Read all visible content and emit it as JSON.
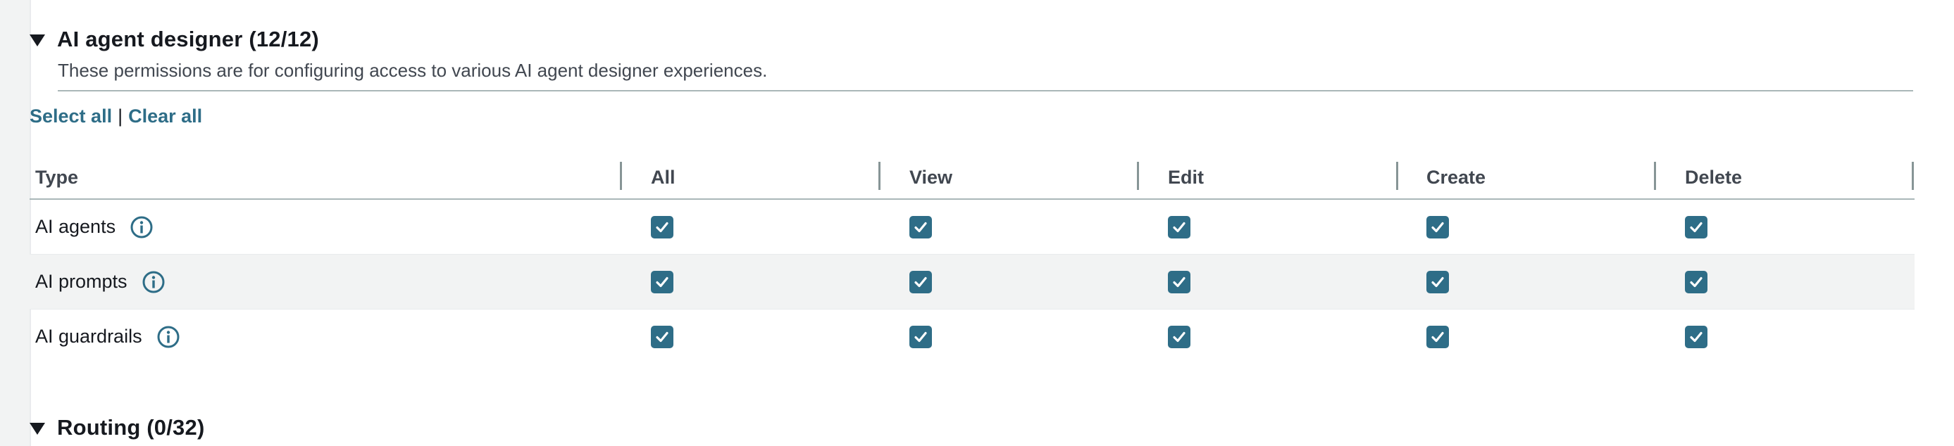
{
  "section": {
    "title": "AI agent designer (12/12)",
    "description": "These permissions are for configuring access to various AI agent designer experiences."
  },
  "actions": {
    "select_all": "Select all",
    "separator": "|",
    "clear_all": "Clear all"
  },
  "table": {
    "headers": [
      "Type",
      "All",
      "View",
      "Edit",
      "Create",
      "Delete"
    ],
    "rows": [
      {
        "type": "AI agents",
        "all": true,
        "view": true,
        "edit": true,
        "create": true,
        "delete": true
      },
      {
        "type": "AI prompts",
        "all": true,
        "view": true,
        "edit": true,
        "create": true,
        "delete": true
      },
      {
        "type": "AI guardrails",
        "all": true,
        "view": true,
        "edit": true,
        "create": true,
        "delete": true
      }
    ]
  },
  "next_section": {
    "title": "Routing (0/32)"
  },
  "colors": {
    "checkbox": "#2e6d87",
    "link": "#2e6d87",
    "row_alt": "#f2f3f3"
  },
  "icons": {
    "row_info": "info-circle-icon",
    "expand": "caret-down-icon",
    "check": "checkmark-icon"
  }
}
